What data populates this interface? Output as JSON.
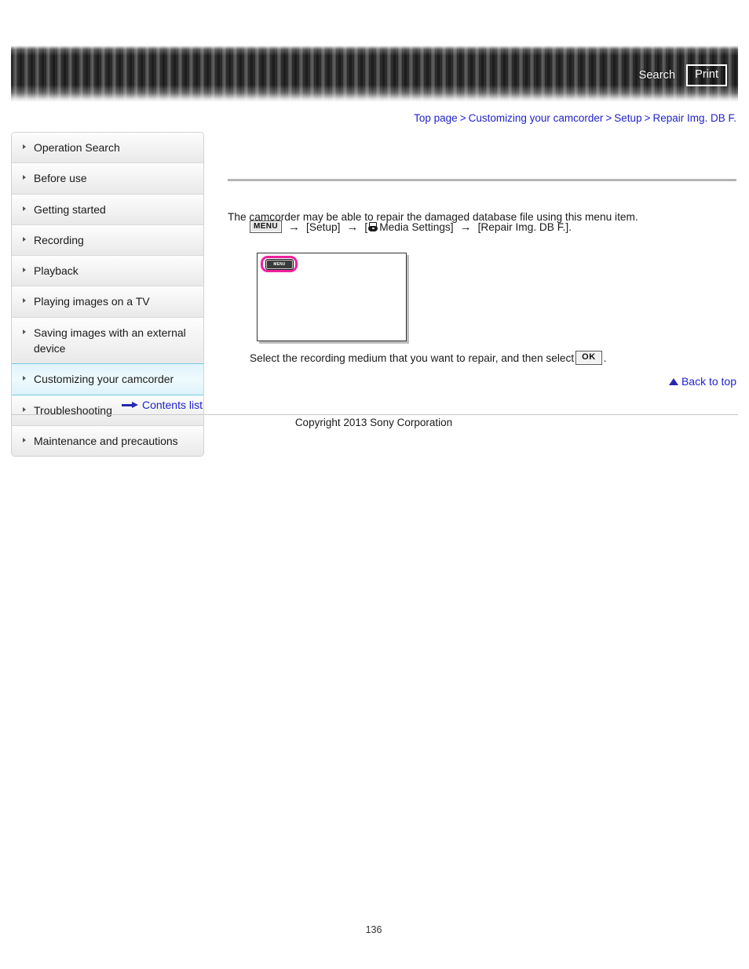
{
  "header": {
    "search_label": "Search",
    "print_label": "Print",
    "search_icon": "search-icon",
    "banner_color": "#2b2b2b"
  },
  "breadcrumb": {
    "separator": ">",
    "link_color": "#2222cc",
    "items": [
      {
        "label": "Top page"
      },
      {
        "label": "Customizing your camcorder"
      },
      {
        "label": "Setup"
      },
      {
        "label": "Repair Img. DB F."
      }
    ]
  },
  "sidebar": {
    "accent_color": "#79c9e4",
    "items": [
      {
        "label": "Operation Search",
        "active": false
      },
      {
        "label": "Before use",
        "active": false
      },
      {
        "label": "Getting started",
        "active": false
      },
      {
        "label": "Recording",
        "active": false
      },
      {
        "label": "Playback",
        "active": false
      },
      {
        "label": "Playing images on a TV",
        "active": false
      },
      {
        "label": "Saving images with an external device",
        "active": false
      },
      {
        "label": "Customizing your camcorder",
        "active": true
      },
      {
        "label": "Troubleshooting",
        "active": false
      },
      {
        "label": "Maintenance and precautions",
        "active": false
      }
    ],
    "contents_list_label": "Contents list",
    "contents_list_icon": "right-arrow-icon"
  },
  "main": {
    "intro_text": "The camcorder may be able to repair the damaged database file using this menu item.",
    "menu_path": {
      "menu_chip_label": "MENU",
      "arrow": "→",
      "step_setup": "[Setup]",
      "step_media_open": "[",
      "step_media_label": "Media Settings]",
      "step_media_icon": "media-settings-icon",
      "step_repair": "[Repair Img. DB F.]."
    },
    "lcd_figure": {
      "menu_button_label": "MENU",
      "highlight_color": "#ef21a0",
      "name": "lcd-screen-illustration"
    },
    "select_line": {
      "text_before": "Select the recording medium that you want to repair, and then select",
      "ok_chip_label": "OK",
      "text_after": "."
    },
    "back_to_top": {
      "label": "Back to top",
      "icon": "triangle-up-icon"
    }
  },
  "footer": {
    "copyright": "Copyright 2013 Sony Corporation",
    "page_number": "136"
  }
}
